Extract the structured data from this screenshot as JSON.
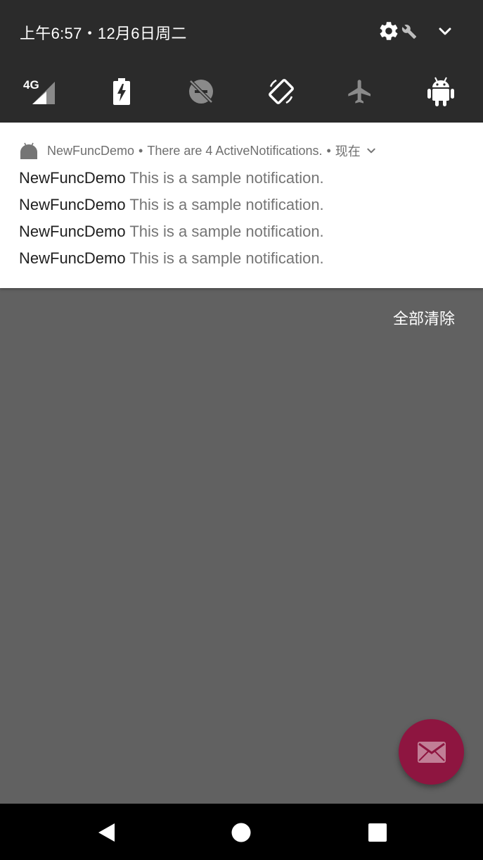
{
  "status": {
    "datetime": "上午6:57・12月6日周二"
  },
  "quick_settings": {
    "tiles": [
      {
        "name": "mobile-data",
        "icon": "signal-4g-icon",
        "label": "4G"
      },
      {
        "name": "battery-saver",
        "icon": "battery-charging-icon"
      },
      {
        "name": "do-not-disturb",
        "icon": "dnd-off-icon"
      },
      {
        "name": "auto-rotate",
        "icon": "rotate-icon"
      },
      {
        "name": "airplane-mode",
        "icon": "airplane-icon"
      },
      {
        "name": "android",
        "icon": "android-icon"
      }
    ]
  },
  "notification": {
    "app_name": "NewFuncDemo",
    "summary": "There are 4 ActiveNotifications.",
    "time": "现在",
    "separator": "•",
    "lines": [
      {
        "title": "NewFuncDemo",
        "text": "This is a sample notification."
      },
      {
        "title": "NewFuncDemo",
        "text": "This is a sample notification."
      },
      {
        "title": "NewFuncDemo",
        "text": "This is a sample notification."
      },
      {
        "title": "NewFuncDemo",
        "text": "This is a sample notification."
      }
    ]
  },
  "actions": {
    "clear_all": "全部清除"
  },
  "colors": {
    "shade_bg": "#2b2b2b",
    "scrim": "#616161",
    "fab": "#8e1540"
  }
}
